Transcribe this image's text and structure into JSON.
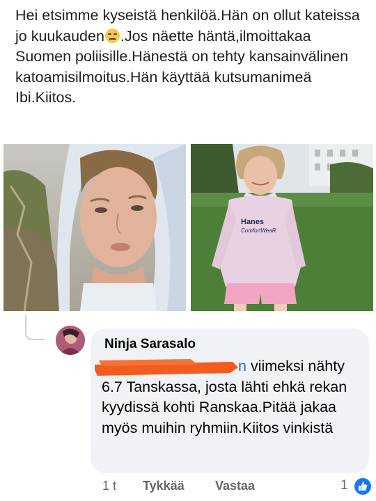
{
  "post": {
    "text_part1": "Hei etsimme kyseistä henkilöä.Hän on ollut kateissa jo kuukauden",
    "emoji": "expressionless-face-emoji",
    "text_part2": ".Jos näette häntä,ilmoittakaa Suomen poliisille.Hänestä on  tehty kansainvälinen katoamisilmoitus.Hän käyttää kutsumanimeä Ibi.Kiitos."
  },
  "photos": {
    "left": "missing-person-photo-hoodie",
    "right": "missing-person-photo-park",
    "right_shirt_text_line1": "Hanes",
    "right_shirt_text_line2": "ComfortWeaR"
  },
  "comment": {
    "author": "Ninja Sarasalo",
    "mention_visible": "n",
    "text": " viimeksi nähty 6.7 Tanskassa, josta lähti ehkä rekan kyydissä kohti Ranskaa.Pitää jakaa myös muihin ryhmiin.Kiitos vinkistä",
    "redaction_color": "#f25c1e",
    "time": "1 t",
    "like_label": "Tykkää",
    "reply_label": "Vastaa",
    "reaction_count": "1",
    "reaction_icon": "thumbs-up-icon",
    "reaction_color": "#1877f2"
  }
}
